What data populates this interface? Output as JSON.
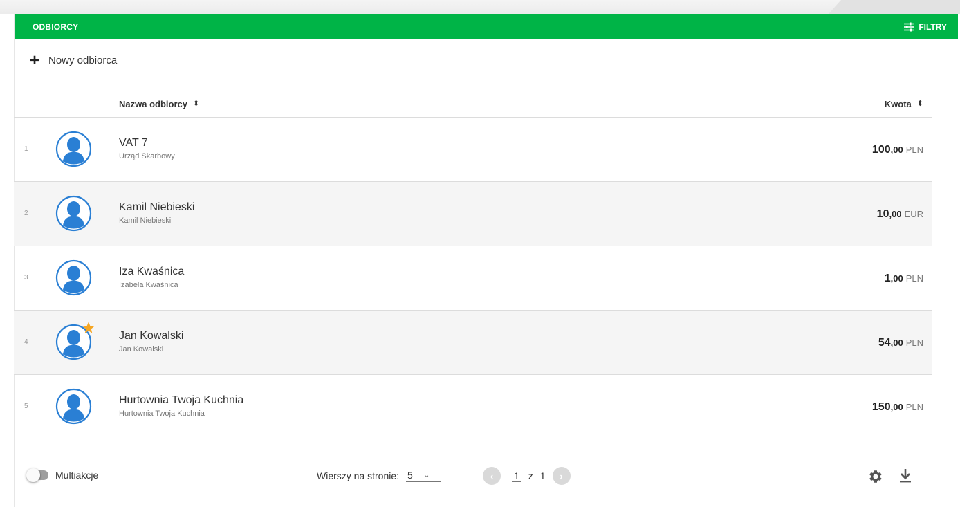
{
  "header": {
    "title": "ODBIORCY",
    "filters_label": "FILTRY",
    "bar_color": "#00b447"
  },
  "toolbar": {
    "new_recipient_label": "Nowy odbiorca"
  },
  "table": {
    "columns": {
      "name": "Nazwa odbiorcy",
      "amount": "Kwota"
    },
    "rows": [
      {
        "index": "1",
        "name": "VAT 7",
        "sub": "Urząd Skarbowy",
        "amount_int": "100",
        "amount_dec": ",00",
        "currency": "PLN",
        "favorite": false
      },
      {
        "index": "2",
        "name": "Kamil Niebieski",
        "sub": "Kamil Niebieski",
        "amount_int": "10",
        "amount_dec": ",00",
        "currency": "EUR",
        "favorite": false
      },
      {
        "index": "3",
        "name": "Iza Kwaśnica",
        "sub": "Izabela Kwaśnica",
        "amount_int": "1",
        "amount_dec": ",00",
        "currency": "PLN",
        "favorite": false
      },
      {
        "index": "4",
        "name": "Jan Kowalski",
        "sub": "Jan Kowalski",
        "amount_int": "54",
        "amount_dec": ",00",
        "currency": "PLN",
        "favorite": true
      },
      {
        "index": "5",
        "name": "Hurtownia Twoja Kuchnia",
        "sub": "Hurtownia Twoja Kuchnia",
        "amount_int": "150",
        "amount_dec": ",00",
        "currency": "PLN",
        "favorite": false
      }
    ]
  },
  "footer": {
    "multi_label": "Multiakcje",
    "rows_per_page_label": "Wierszy na stronie:",
    "rows_per_page_value": "5",
    "page_current": "1",
    "page_separator": "z",
    "page_total": "1"
  },
  "icons": {
    "filters": "sliders-icon",
    "add": "plus-icon",
    "sort": "sort-icon",
    "avatar": "user-avatar-icon",
    "favorite": "star-icon",
    "prev": "chevron-left-icon",
    "next": "chevron-right-icon",
    "settings": "gear-icon",
    "download": "download-icon"
  },
  "colors": {
    "accent": "#00b447",
    "avatar": "#2a7fd4",
    "star": "#f5a623"
  }
}
